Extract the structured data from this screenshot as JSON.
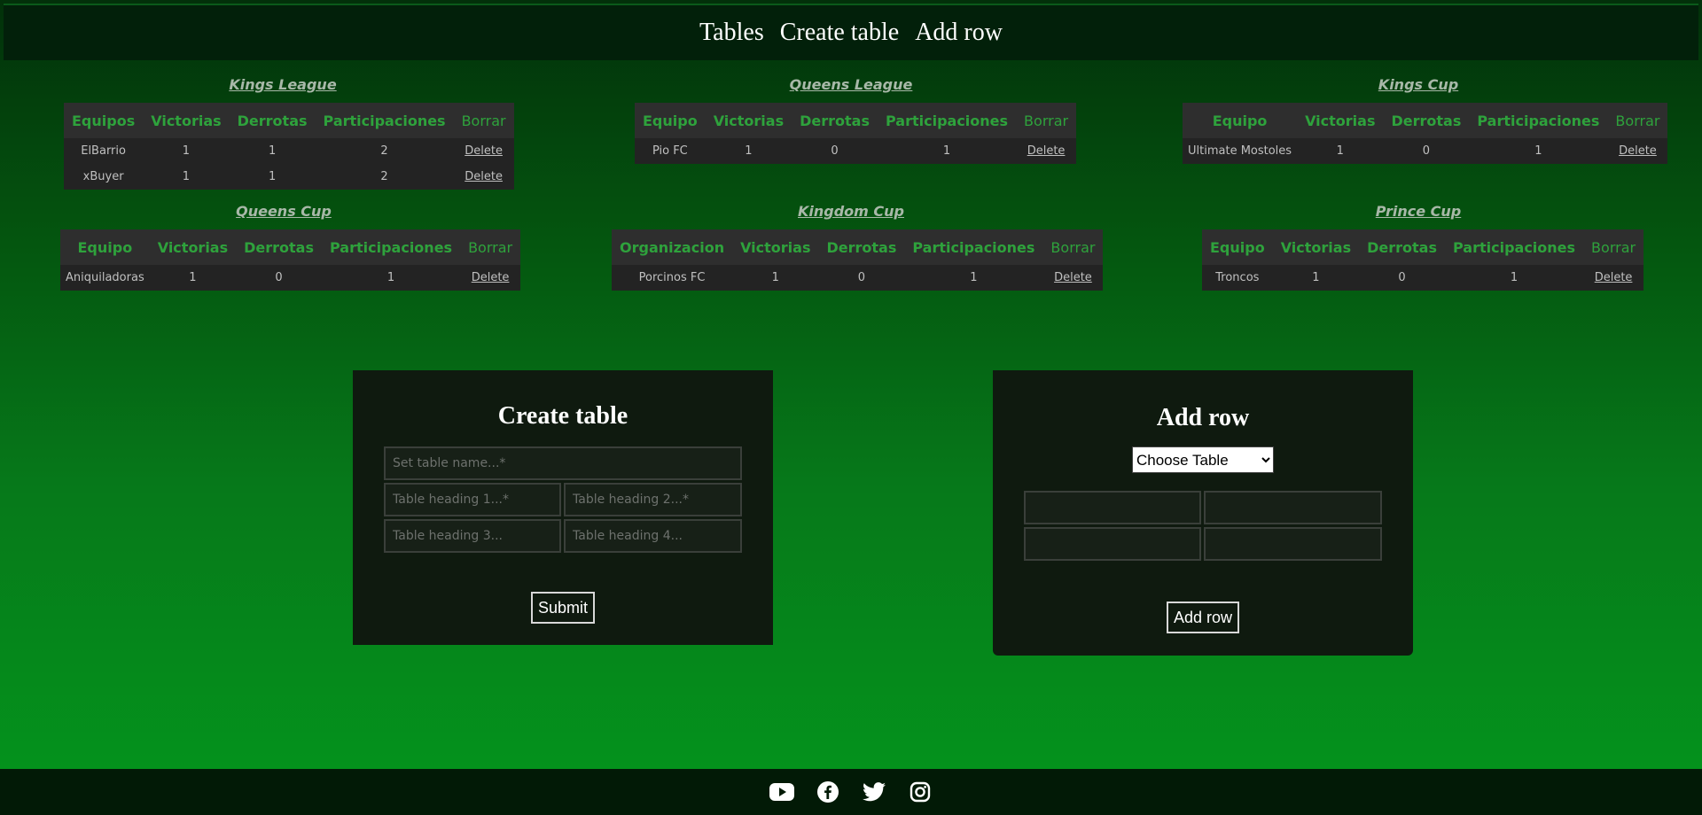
{
  "nav": {
    "tables": "Tables",
    "create_table": "Create table",
    "add_row": "Add row"
  },
  "tables": {
    "kings_league": {
      "title": "Kings League",
      "headers": [
        "Equipos",
        "Victorias",
        "Derrotas",
        "Participaciones",
        "Borrar"
      ],
      "rows": [
        [
          "ElBarrio",
          "1",
          "1",
          "2",
          "Delete"
        ],
        [
          "xBuyer",
          "1",
          "1",
          "2",
          "Delete"
        ]
      ]
    },
    "queens_league": {
      "title": "Queens League",
      "headers": [
        "Equipo",
        "Victorias",
        "Derrotas",
        "Participaciones",
        "Borrar"
      ],
      "rows": [
        [
          "Pio FC",
          "1",
          "0",
          "1",
          "Delete"
        ]
      ]
    },
    "kings_cup": {
      "title": "Kings Cup",
      "headers": [
        "Equipo",
        "Victorias",
        "Derrotas",
        "Participaciones",
        "Borrar"
      ],
      "rows": [
        [
          "Ultimate Mostoles",
          "1",
          "0",
          "1",
          "Delete"
        ]
      ]
    },
    "queens_cup": {
      "title": "Queens Cup",
      "headers": [
        "Equipo",
        "Victorias",
        "Derrotas",
        "Participaciones",
        "Borrar"
      ],
      "rows": [
        [
          "Aniquiladoras",
          "1",
          "0",
          "1",
          "Delete"
        ]
      ]
    },
    "kingdom_cup": {
      "title": "Kingdom Cup",
      "headers": [
        "Organizacion",
        "Victorias",
        "Derrotas",
        "Participaciones",
        "Borrar"
      ],
      "rows": [
        [
          "Porcinos FC",
          "1",
          "0",
          "1",
          "Delete"
        ]
      ]
    },
    "prince_cup": {
      "title": "Prince Cup",
      "headers": [
        "Equipo",
        "Victorias",
        "Derrotas",
        "Participaciones",
        "Borrar"
      ],
      "rows": [
        [
          "Troncos",
          "1",
          "0",
          "1",
          "Delete"
        ]
      ]
    }
  },
  "create_form": {
    "title": "Create table",
    "name_placeholder": "Set table name...*",
    "heading1_placeholder": "Table heading 1...*",
    "heading2_placeholder": "Table heading 2...*",
    "heading3_placeholder": "Table heading 3...",
    "heading4_placeholder": "Table heading 4...",
    "submit_label": "Submit"
  },
  "add_row_form": {
    "title": "Add row",
    "select_value": "Choose Table",
    "submit_label": "Add row"
  },
  "footer": {
    "icons": [
      "youtube-icon",
      "facebook-icon",
      "twitter-icon",
      "instagram-icon"
    ]
  }
}
